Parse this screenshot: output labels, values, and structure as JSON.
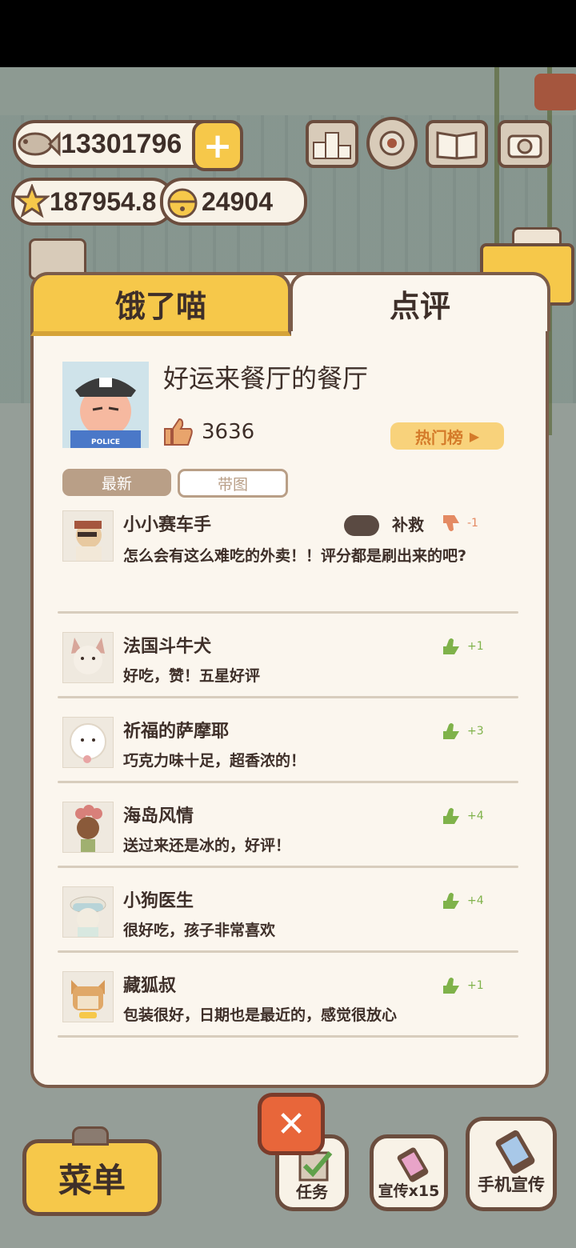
{
  "hud": {
    "fish_count": "13301796",
    "star_count": "187954.8",
    "bell_count": "24904"
  },
  "tabs": {
    "hungry_cat": "饿了喵",
    "reviews": "点评"
  },
  "restaurant": {
    "name": "好运来餐厅的餐厅",
    "likes": "3636",
    "hot_list_label": "热门榜",
    "avatar_badge": "POLICE"
  },
  "filters": {
    "latest": "最新",
    "with_photo": "带图"
  },
  "reviews": [
    {
      "name": "小小赛车手",
      "text": "怎么会有这么难吃的外卖！！评分都是刷出来的吧?",
      "score": "-1",
      "positive": false,
      "action": "补救"
    },
    {
      "name": "法国斗牛犬",
      "text": "好吃，赞！五星好评",
      "score": "+1",
      "positive": true
    },
    {
      "name": "祈福的萨摩耶",
      "text": "巧克力味十足，超香浓的！",
      "score": "+3",
      "positive": true
    },
    {
      "name": "海岛风情",
      "text": "送过来还是冰的，好评！",
      "score": "+4",
      "positive": true
    },
    {
      "name": "小狗医生",
      "text": "很好吃，孩子非常喜欢",
      "score": "+4",
      "positive": true
    },
    {
      "name": "藏狐叔",
      "text": "包装很好，日期也是最近的，感觉很放心",
      "score": "+1",
      "positive": true
    }
  ],
  "bottom": {
    "menu": "菜单",
    "tasks": "任务",
    "promote": "宣传x15",
    "phone_promote": "手机宣传"
  },
  "colors": {
    "tab_active": "#f6c84a",
    "panel_bg": "#fbf6ee",
    "border": "#7b5c4a",
    "thumb_up": "#7fb24a",
    "thumb_down": "#e48a63",
    "close": "#e8663a"
  }
}
